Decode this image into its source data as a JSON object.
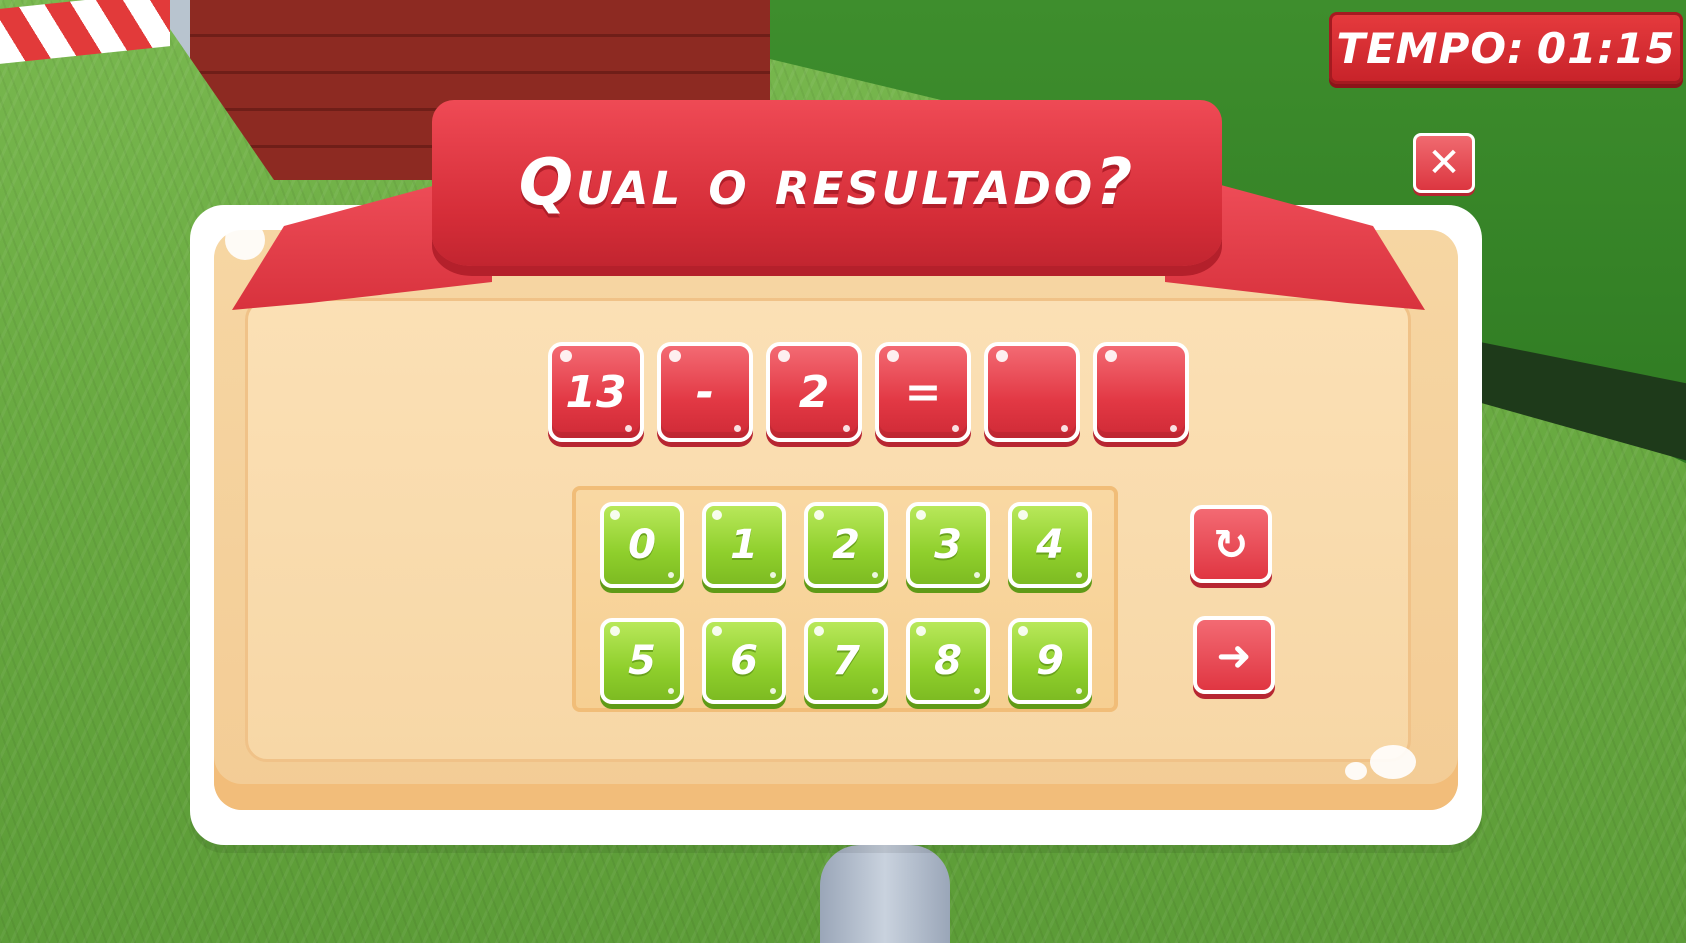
{
  "timer": {
    "label": "TEMPO:",
    "value": "01:15"
  },
  "close": {
    "icon": "close-icon",
    "glyph": "✕"
  },
  "title": "Qual o resultado?",
  "equation": {
    "tiles": [
      "13",
      "-",
      "2",
      "=",
      "",
      ""
    ]
  },
  "keypad": {
    "keys": [
      "0",
      "1",
      "2",
      "3",
      "4",
      "5",
      "6",
      "7",
      "8",
      "9"
    ]
  },
  "actions": {
    "reset_icon": "reset-icon",
    "reset_glyph": "↻",
    "next_icon": "next-arrow-icon",
    "next_glyph": "➜"
  },
  "colors": {
    "tile_red": "#e23844",
    "key_green": "#8fcf2c",
    "board": "#f6d6a3",
    "ribbon": "#d52d38"
  }
}
